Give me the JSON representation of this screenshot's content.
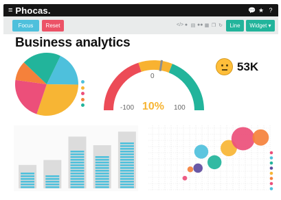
{
  "app": {
    "brand": "Phocas."
  },
  "topbar": {
    "icons": [
      "chat-icon",
      "star-icon",
      "help-icon"
    ]
  },
  "toolbar": {
    "focus_label": "Focus",
    "reset_label": "Reset",
    "line_label": "Line",
    "widget_label": "Widget ▾",
    "icons": [
      "code-icon",
      "info-icon",
      "print-icon",
      "people-icon",
      "grid-icon",
      "copy-icon",
      "refresh-icon"
    ]
  },
  "page": {
    "title": "Business analytics"
  },
  "kpi": {
    "value": "53K",
    "icon": "neutral-face-icon"
  },
  "gauge": {
    "min_label": "-100",
    "mid_label": "0",
    "max_label": "100",
    "value_label": "10%",
    "value": 10,
    "colors": [
      "#ec4b57",
      "#f8b231",
      "#22b49b"
    ]
  },
  "colors": {
    "cyan": "#4ec0dc",
    "yellow": "#f7b534",
    "pink": "#ec4f7a",
    "orange": "#f5813b",
    "green": "#22b49b",
    "purple": "#5d4b9e",
    "dark": "#151515"
  },
  "chart_data": [
    {
      "type": "pie",
      "values": [
        18,
        30,
        22,
        10,
        20
      ],
      "colors": [
        "#4ec0dc",
        "#f7b534",
        "#ec4f7a",
        "#f5813b",
        "#22b49b"
      ],
      "legend": "right"
    },
    {
      "type": "bar",
      "series": [
        {
          "values": [
            38,
            46,
            84,
            70,
            92
          ]
        },
        {
          "values": [
            30,
            24,
            66,
            54,
            76
          ]
        }
      ],
      "colors": [
        "#dcdcdc",
        "#4ec0dc"
      ]
    },
    {
      "type": "scatter",
      "points": [
        {
          "x": 3,
          "y": 1.5,
          "r": 2,
          "color": "#ec4f7a"
        },
        {
          "x": 3.5,
          "y": 3,
          "r": 2.5,
          "color": "#f5813b"
        },
        {
          "x": 4.2,
          "y": 3.2,
          "r": 4,
          "color": "#5d4b9e"
        },
        {
          "x": 4.5,
          "y": 6,
          "r": 6,
          "color": "#4ec0dc"
        },
        {
          "x": 5.7,
          "y": 4.2,
          "r": 6,
          "color": "#22b49b"
        },
        {
          "x": 7,
          "y": 6.6,
          "r": 7,
          "color": "#f7b534"
        },
        {
          "x": 8.3,
          "y": 8.2,
          "r": 10,
          "color": "#ec4f7a"
        },
        {
          "x": 9.9,
          "y": 8.4,
          "r": 7,
          "color": "#f5813b"
        }
      ],
      "legend_colors": [
        "#ec4f7a",
        "#4ec0dc",
        "#22b49b",
        "#5d4b9e",
        "#f7b534",
        "#f5813b",
        "#ec4f7a",
        "#4ec0dc"
      ],
      "grid": true,
      "legend": "right"
    }
  ]
}
